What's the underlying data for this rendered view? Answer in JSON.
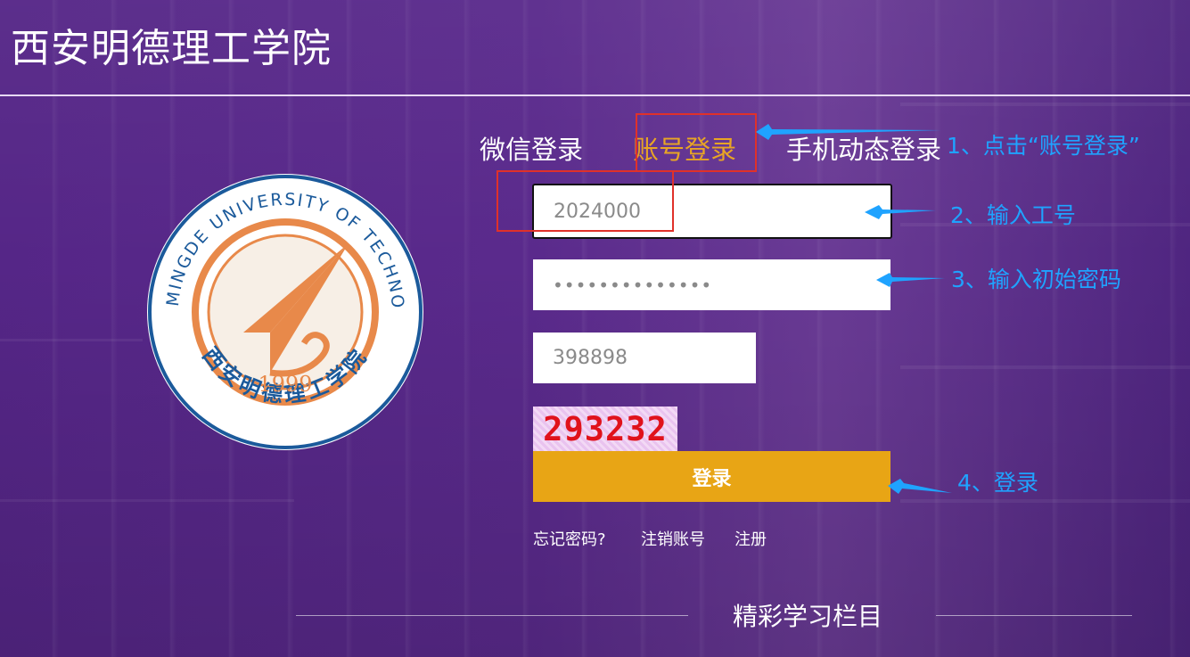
{
  "header": {
    "title": "西安明德理工学院"
  },
  "tabs": [
    {
      "label": "微信登录",
      "active": false
    },
    {
      "label": "账号登录",
      "active": true
    },
    {
      "label": "手机动态登录",
      "active": false
    }
  ],
  "form": {
    "username_value": "2024000",
    "password_value": "••••••••••••••",
    "captcha_input_value": "398898",
    "captcha_image_text": "293232",
    "login_label": "登录"
  },
  "links": {
    "forgot": "忘记密码?",
    "cancel_account": "注销账号",
    "register": "注册"
  },
  "section": {
    "title": "精彩学习栏目"
  },
  "logo": {
    "top_text": "XIAN MINGDE UNIVERSITY OF TECHNOLOGY",
    "bottom_text": "西安明德理工学院",
    "year": "1999"
  },
  "annotations": {
    "step1": "1、点击“账号登录”",
    "step2": "2、输入工号",
    "step3": "3、输入初始密码",
    "step4": "4、登录"
  },
  "colors": {
    "background": "#552687",
    "accent": "#e8a515",
    "annotation": "#1fa3ff",
    "highlight_box": "#e0312a",
    "captcha_text": "#e0121b"
  },
  "icons": {
    "arrow": "arrow-left-icon"
  }
}
